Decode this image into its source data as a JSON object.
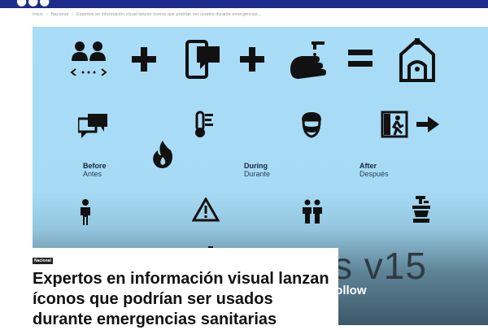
{
  "header": {
    "logo_text": "●●●",
    "bg_color": "#1d2c8a"
  },
  "breadcrumb": {
    "items": [
      "Inicio",
      "Nacional",
      "Expertos en información visual lanzan íconos que podrían ser usados durante emergencias..."
    ],
    "separator": "›"
  },
  "hero": {
    "icons": [
      "people-distance-icon",
      "plus-icon",
      "phone-message-icon",
      "plus-icon",
      "hand-washing-icon",
      "equals-icon",
      "home-icon",
      "chat-icon",
      "thermometer-icon",
      "face-mask-icon",
      "exit-door-icon",
      "arrow-right-icon",
      "fire-icon",
      "person-icon",
      "warning-icon",
      "couple-icon",
      "sink-icon"
    ],
    "equals_text": "=",
    "phases": [
      {
        "en": "Before",
        "es": "Antes"
      },
      {
        "en": "During",
        "es": "Durante"
      },
      {
        "en": "After",
        "es": "Después"
      }
    ],
    "version_text": "s v15",
    "follow_text": "Follow"
  },
  "article": {
    "category": "Nacional",
    "title": "Expertos en información visual lanzan íconos que podrían ser usados durante emergencias sanitarias"
  },
  "colors": {
    "icon": "#111111",
    "hero_top": "#a9ddf7",
    "hero_bottom": "#3c5969"
  }
}
